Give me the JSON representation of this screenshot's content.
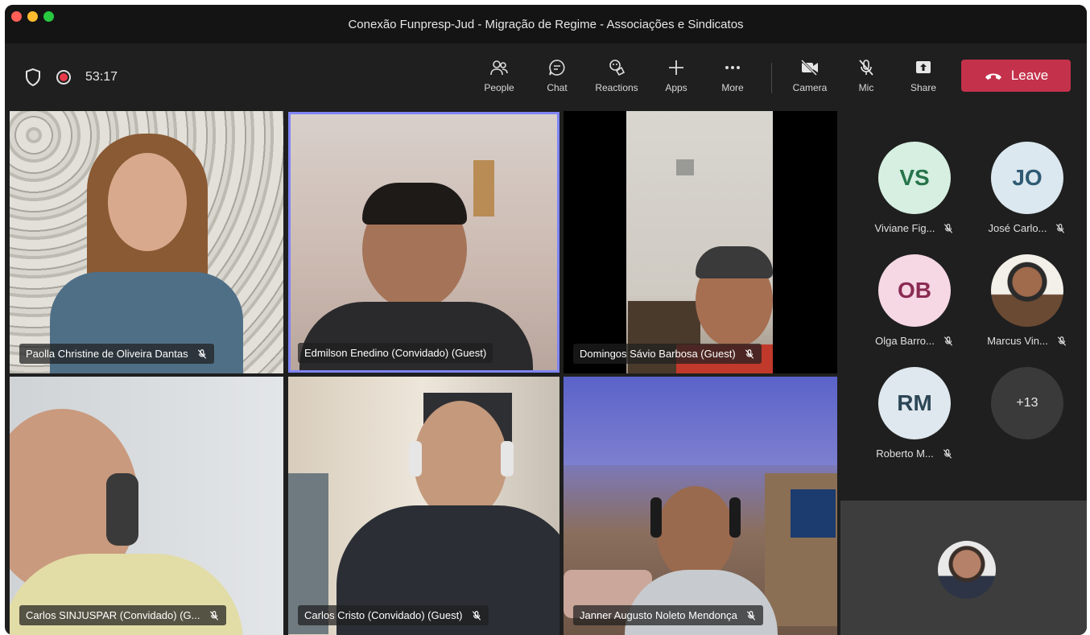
{
  "window": {
    "title": "Conexão Funpresp-Jud - Migração de Regime - Associações e Sindicatos"
  },
  "toolbar": {
    "timer": "53:17",
    "buttons": {
      "people": "People",
      "chat": "Chat",
      "reactions": "Reactions",
      "apps": "Apps",
      "more": "More",
      "camera": "Camera",
      "mic": "Mic",
      "share": "Share"
    },
    "leave_label": "Leave"
  },
  "tiles": [
    {
      "name": "Paolla Christine de Oliveira Dantas",
      "muted": true
    },
    {
      "name": "Edmilson Enedino (Convidado) (Guest)",
      "muted": false,
      "active_speaker": true
    },
    {
      "name": "Domingos Sávio Barbosa (Guest)",
      "muted": true
    },
    {
      "name": "Carlos SINJUSPAR (Convidado) (G...",
      "muted": true
    },
    {
      "name": "Carlos Cristo (Convidado) (Guest)",
      "muted": true
    },
    {
      "name": "Janner Augusto Noleto Mendonça",
      "muted": true
    }
  ],
  "participants": [
    {
      "initials": "VS",
      "name": "Viviane Fig...",
      "muted": true
    },
    {
      "initials": "JO",
      "name": "José Carlo...",
      "muted": true
    },
    {
      "initials": "OB",
      "name": "Olga Barro...",
      "muted": true
    },
    {
      "initials": "",
      "name": "Marcus Vin...",
      "muted": true
    },
    {
      "initials": "RM",
      "name": "Roberto M...",
      "muted": true
    }
  ],
  "overflow_count": "+13",
  "colors": {
    "leave": "#c4314b",
    "active_border": "#7f85f5",
    "avatar_vs_bg": "#d6efe1",
    "avatar_vs_fg": "#26734a",
    "avatar_jo_bg": "#dbe8ef",
    "avatar_jo_fg": "#2e5a73",
    "avatar_ob_bg": "#f6d7e4",
    "avatar_ob_fg": "#8a2b52",
    "avatar_rm_bg": "#dfe8ee",
    "avatar_rm_fg": "#2c4656"
  }
}
